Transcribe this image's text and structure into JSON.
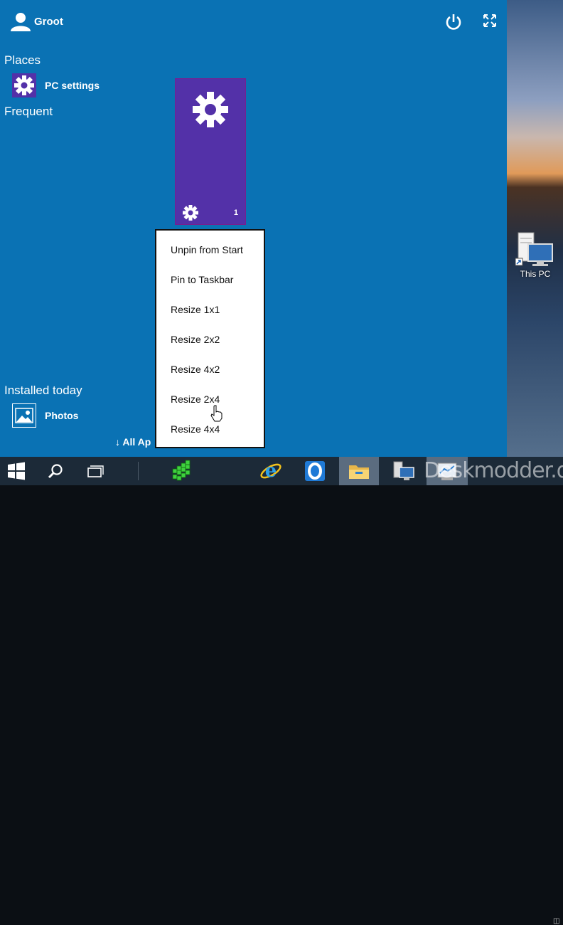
{
  "start": {
    "user_name": "Groot",
    "sections": {
      "places": "Places",
      "frequent": "Frequent",
      "installed_today": "Installed today"
    },
    "places_items": [
      {
        "label": "PC settings",
        "icon": "gear-icon"
      }
    ],
    "installed_items": [
      {
        "label": "Photos",
        "icon": "photos-icon"
      }
    ],
    "all_apps_label": "All Ap",
    "tile": {
      "badge": "1",
      "color": "#5331a8",
      "icon": "gear-icon"
    }
  },
  "context_menu": {
    "items": [
      "Unpin from Start",
      "Pin to Taskbar",
      "Resize 1x1",
      "Resize 2x2",
      "Resize 4x2",
      "Resize 2x4",
      "Resize 4x4"
    ]
  },
  "desktop": {
    "this_pc_label": "This PC"
  },
  "taskbar": {
    "items": [
      "windows-start-icon",
      "search-icon",
      "task-view-icon",
      "green-app-icon",
      "internet-explorer-icon",
      "opera-icon",
      "file-explorer-icon",
      "remote-desktop-icon",
      "control-panel-icon"
    ]
  },
  "watermark": "Deskmodder.de",
  "colors": {
    "start_bg": "#0a72b4",
    "tile_bg": "#5331a8",
    "taskbar_bg": "#1c2a38"
  }
}
